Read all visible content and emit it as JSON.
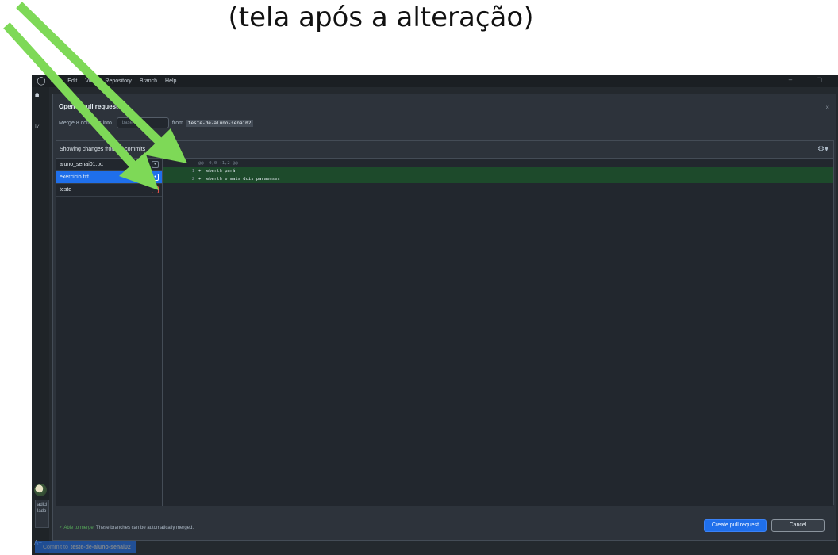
{
  "caption": "(tela após a alteração)",
  "menubar": {
    "items": [
      "File",
      "Edit",
      "View",
      "Repository",
      "Branch",
      "Help"
    ],
    "window_controls": "– ▢"
  },
  "sidebar": {
    "box_text_1": "adici",
    "box_text_2": "lado"
  },
  "commit_button": {
    "prefix": "Commit to",
    "branch": "teste-de-aluno-senai02"
  },
  "dialog": {
    "title": "Open a pull request",
    "close": "×",
    "merge_prefix": "Merge 8 commits into",
    "base_label": "base: main",
    "from_label": "from",
    "head_branch": "teste-de-aluno-senai02"
  },
  "changes": {
    "header": "Showing changes from all commits",
    "files": [
      {
        "name": "aluno_senai01.txt",
        "status": "modified",
        "badge": "•"
      },
      {
        "name": "exercicio.txt",
        "status": "modified",
        "badge": "•",
        "selected": true
      },
      {
        "name": "teste",
        "status": "deleted",
        "badge": "−"
      }
    ]
  },
  "diff": {
    "hunk": "@@ -0,0 +1,2 @@",
    "lines": [
      {
        "old": "",
        "new": "1",
        "marker": "+",
        "text": "eberth pará"
      },
      {
        "old": "",
        "new": "2",
        "marker": "+",
        "text": "eberth e mais dois paraenses"
      }
    ]
  },
  "footer": {
    "status": "✓ Able to merge.",
    "message": "These branches can be automatically merged.",
    "create_label": "Create pull request",
    "cancel_label": "Cancel"
  },
  "colors": {
    "accent": "#1f6feb",
    "diff_added_bg": "#1d4a2b",
    "arrow": "#7ed957"
  }
}
